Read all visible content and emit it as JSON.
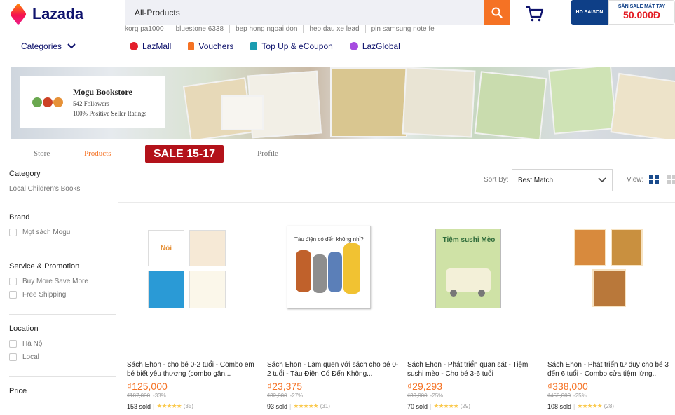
{
  "header": {
    "logo_text": "Lazada",
    "search_value": "All-Products",
    "keywords": [
      "korg pa1000",
      "bluestone 6338",
      "bep hong ngoai don",
      "heo dau xe lead",
      "pin samsung note fe"
    ],
    "promo_banner": {
      "brand": "HD SAISON",
      "headline": "SĂN SALE MÁT TAY",
      "amount": "50.000Đ"
    }
  },
  "nav": {
    "categories_label": "Categories",
    "links": [
      {
        "label": "LazMall",
        "icon": "lazmall-icon",
        "color": "#e41f2c"
      },
      {
        "label": "Vouchers",
        "icon": "voucher-icon",
        "color": "#f57224"
      },
      {
        "label": "Top Up & eCoupon",
        "icon": "topup-icon",
        "color": "#1a9cb0"
      },
      {
        "label": "LazGlobal",
        "icon": "lazglobal-icon",
        "color": "#a64ce0"
      }
    ]
  },
  "store": {
    "name": "Mogu Bookstore",
    "followers": "542 Followers",
    "rating": "100% Positive Seller Ratings",
    "tabs": [
      "Store",
      "Products",
      "Profile"
    ],
    "active_tab": "Products",
    "sale_badge": "SALE 15-17"
  },
  "filters": {
    "category": {
      "title": "Category",
      "link": "Local Children's Books"
    },
    "brand": {
      "title": "Brand",
      "options": [
        "Mọt sách Mogu"
      ]
    },
    "service": {
      "title": "Service & Promotion",
      "options": [
        "Buy More Save More",
        "Free Shipping"
      ]
    },
    "location": {
      "title": "Location",
      "options": [
        "Hà Nội",
        "Local"
      ]
    },
    "price": {
      "title": "Price"
    }
  },
  "sort": {
    "label": "Sort By:",
    "value": "Best Match",
    "view_label": "View:"
  },
  "products": [
    {
      "name": "Sách Ehon - cho bé 0-2 tuổi - Combo em bé biết yêu thương (combo gân...",
      "price": "₫125,000",
      "original": "₫187,000",
      "discount": "-33%",
      "sold": "153 sold",
      "reviews": "(35)"
    },
    {
      "name": "Sách Ehon - Làm quen với sách cho bé 0-2 tuổi - Tàu Điện Có Đến Không...",
      "price": "₫23,375",
      "original": "₫32,000",
      "discount": "-27%",
      "sold": "93 sold",
      "reviews": "(31)"
    },
    {
      "name": "Sách Ehon - Phát triển quan sát - Tiệm sushi mèo - Cho bé 3-6 tuổi",
      "price": "₫29,293",
      "original": "₫39,000",
      "discount": "-25%",
      "sold": "70 sold",
      "reviews": "(29)"
    },
    {
      "name": "Sách Ehon - Phát triển tư duy cho bé 3 đến 6 tuổi - Combo cửa tiệm lừng...",
      "price": "₫338,000",
      "original": "₫450,000",
      "discount": "-25%",
      "sold": "108 sold",
      "reviews": "(28)"
    }
  ],
  "product_cover_texts": [
    "Nói",
    "Tàu điện có đến không nhỉ?",
    "Tiệm sushi Mèo"
  ],
  "colors": {
    "accent": "#f57224",
    "brand_navy": "#0f136d",
    "sale_red": "#b3121a"
  }
}
